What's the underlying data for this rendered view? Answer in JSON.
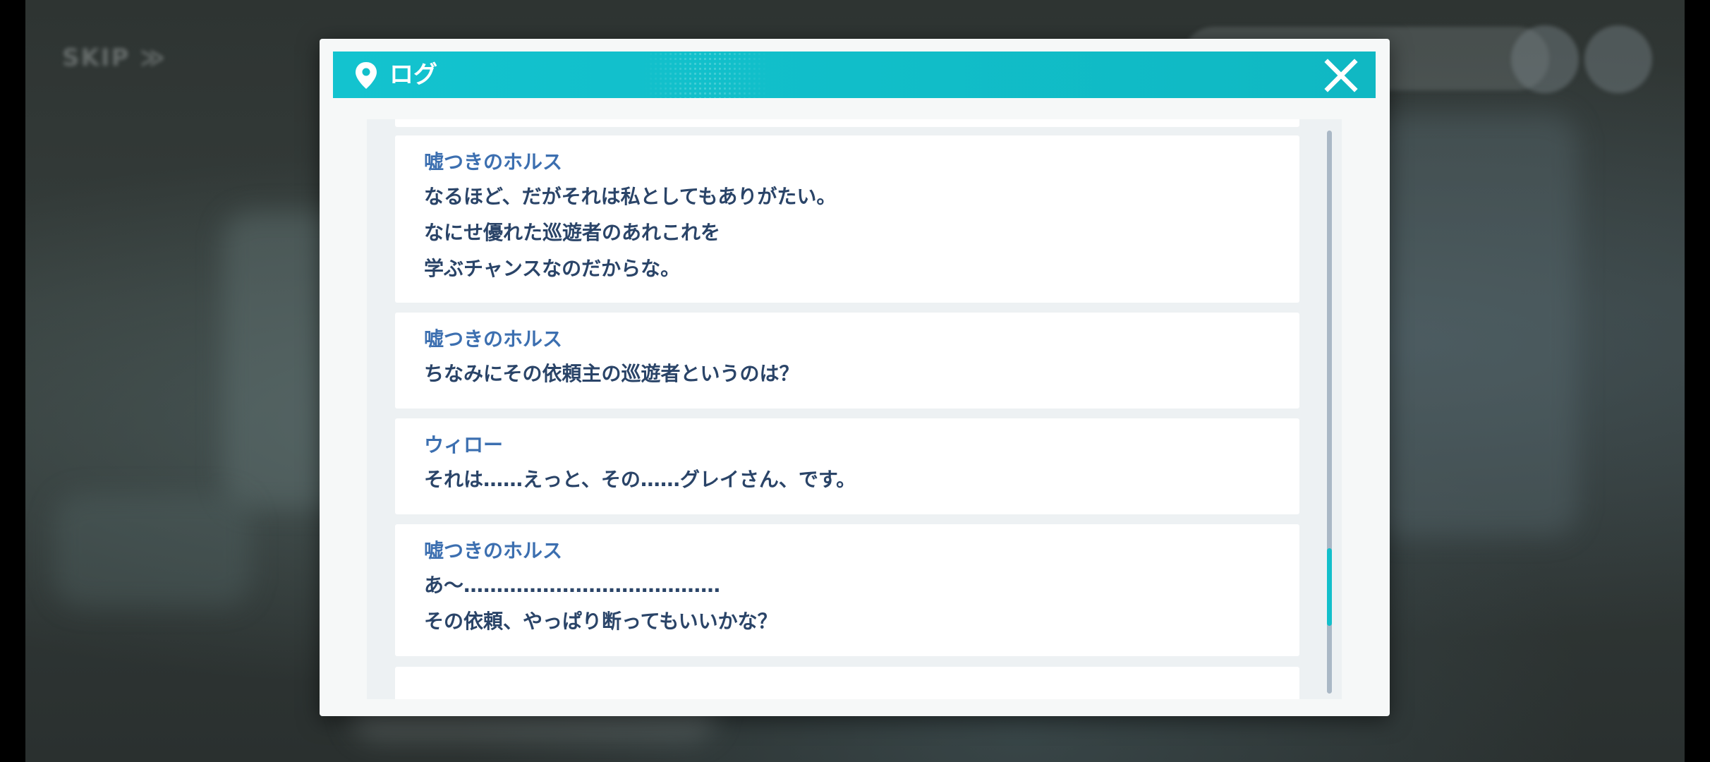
{
  "background": {
    "skip_label": "SKIP ≫"
  },
  "dialog": {
    "title": "ログ",
    "icons": {
      "header": "map-pin-icon",
      "close": "close-icon"
    },
    "accent_color": "#13c3cf"
  },
  "log": {
    "entries": [
      {
        "speaker": "嘘つきのホルス",
        "lines": [
          "なるほど、だがそれは私としてもありがたい。",
          "なにせ優れた巡遊者のあれこれを",
          "学ぶチャンスなのだからな。"
        ]
      },
      {
        "speaker": "嘘つきのホルス",
        "lines": [
          "ちなみにその依頼主の巡遊者というのは？"
        ]
      },
      {
        "speaker": "ウィロー",
        "lines": [
          "それは……えっと、その……グレイさん、です。"
        ]
      },
      {
        "speaker": "嘘つきのホルス",
        "lines": [
          "あ〜…………………………………",
          "その依頼、やっぱり断ってもいいかな？"
        ]
      }
    ]
  },
  "scrollbar": {
    "position": 0.86
  }
}
